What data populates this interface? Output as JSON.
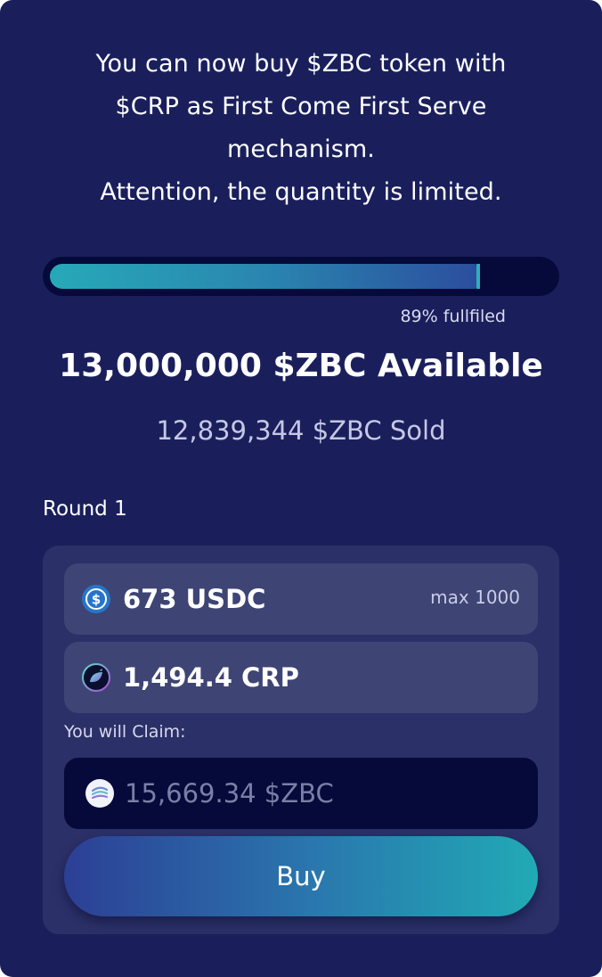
{
  "intro": {
    "lines": [
      "You can now buy $ZBC token with",
      "$CRP as First Come First Serve",
      "mechanism.",
      "Attention, the quantity is limited."
    ]
  },
  "progress": {
    "percent": 89,
    "label": "89% fullfiled",
    "fill_color_start": "#27a9b8",
    "fill_color_end": "#2b4e9e"
  },
  "supply": {
    "available": "13,000,000 $ZBC Available",
    "sold": "12,839,344 $ZBC Sold"
  },
  "round": {
    "label": "Round 1"
  },
  "pay_usdc": {
    "icon": "usdc-icon",
    "value": "673 USDC",
    "max_hint": "max 1000"
  },
  "pay_crp": {
    "icon": "crp-icon",
    "value": "1,494.4 CRP"
  },
  "claim": {
    "label": "You will Claim:",
    "icon": "zbc-icon",
    "value": "15,669.34 $ZBC"
  },
  "buy_button": {
    "label": "Buy"
  },
  "colors": {
    "card_bg": "#1a1f5c",
    "panel_bg": "#2b3068",
    "field_bg": "#3e4575",
    "dark_field_bg": "#050a3a",
    "accent": "#21aab5"
  }
}
